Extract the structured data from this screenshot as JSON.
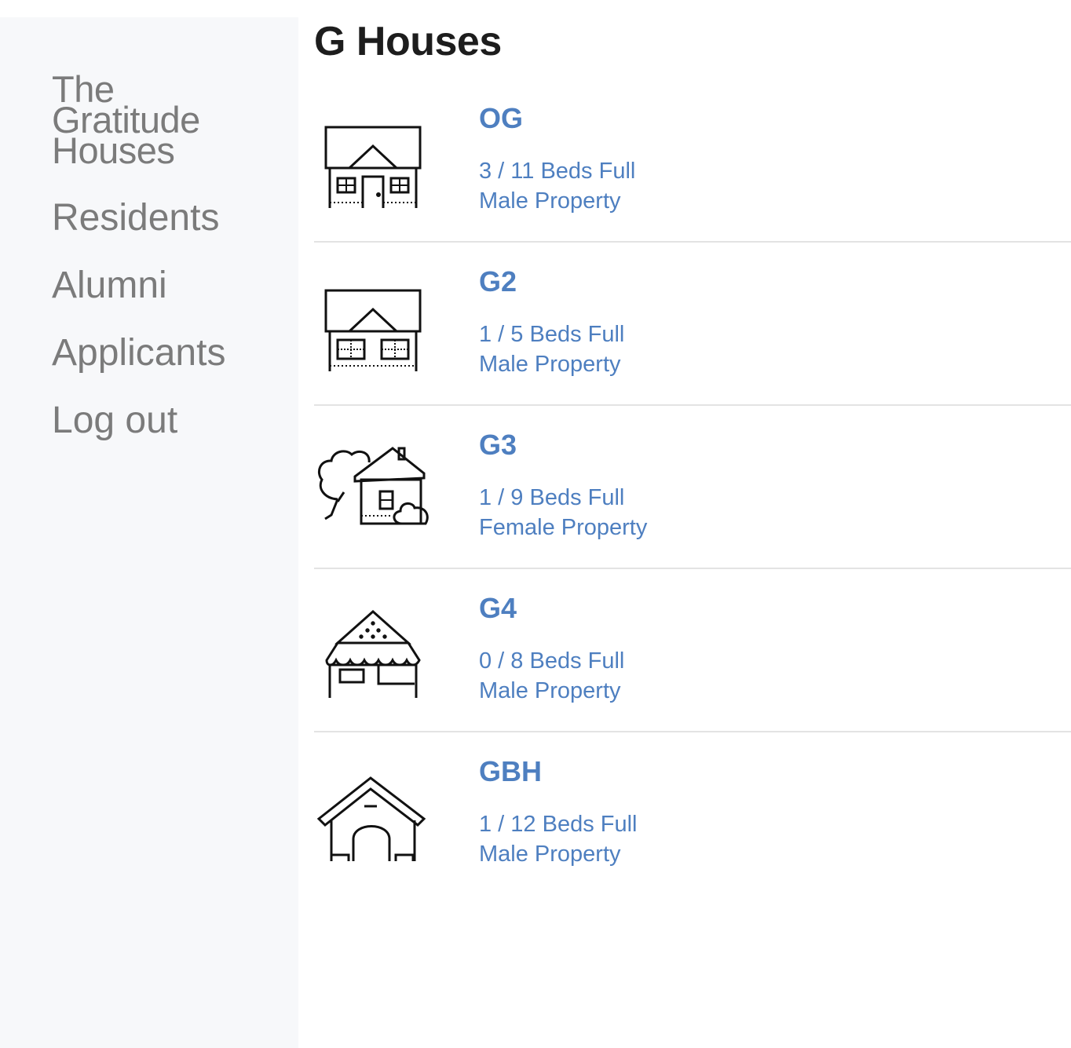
{
  "sidebar": {
    "brand_lines": [
      "The",
      "Gratitude",
      "Houses"
    ],
    "nav": [
      {
        "label": "Residents"
      },
      {
        "label": "Alumni"
      },
      {
        "label": "Applicants"
      },
      {
        "label": "Log out"
      }
    ]
  },
  "main": {
    "title": "G Houses",
    "houses": [
      {
        "name": "OG",
        "beds": "3 / 11 Beds Full",
        "gender": "Male Property",
        "icon": "house-door-two-windows-icon"
      },
      {
        "name": "G2",
        "beds": "1 / 5 Beds Full",
        "gender": "Male Property",
        "icon": "house-two-windows-icon"
      },
      {
        "name": "G3",
        "beds": "1 / 9 Beds Full",
        "gender": "Female Property",
        "icon": "house-with-tree-icon"
      },
      {
        "name": "G4",
        "beds": "0 / 8 Beds Full",
        "gender": "Male Property",
        "icon": "cottage-icon"
      },
      {
        "name": "GBH",
        "beds": "1 / 12 Beds Full",
        "gender": "Male Property",
        "icon": "barn-house-icon"
      }
    ]
  },
  "colors": {
    "link_blue": "#4e7fc0",
    "sidebar_bg": "#f7f8fa",
    "sidebar_text": "#7b7b7b",
    "title_text": "#1d1d1d"
  }
}
